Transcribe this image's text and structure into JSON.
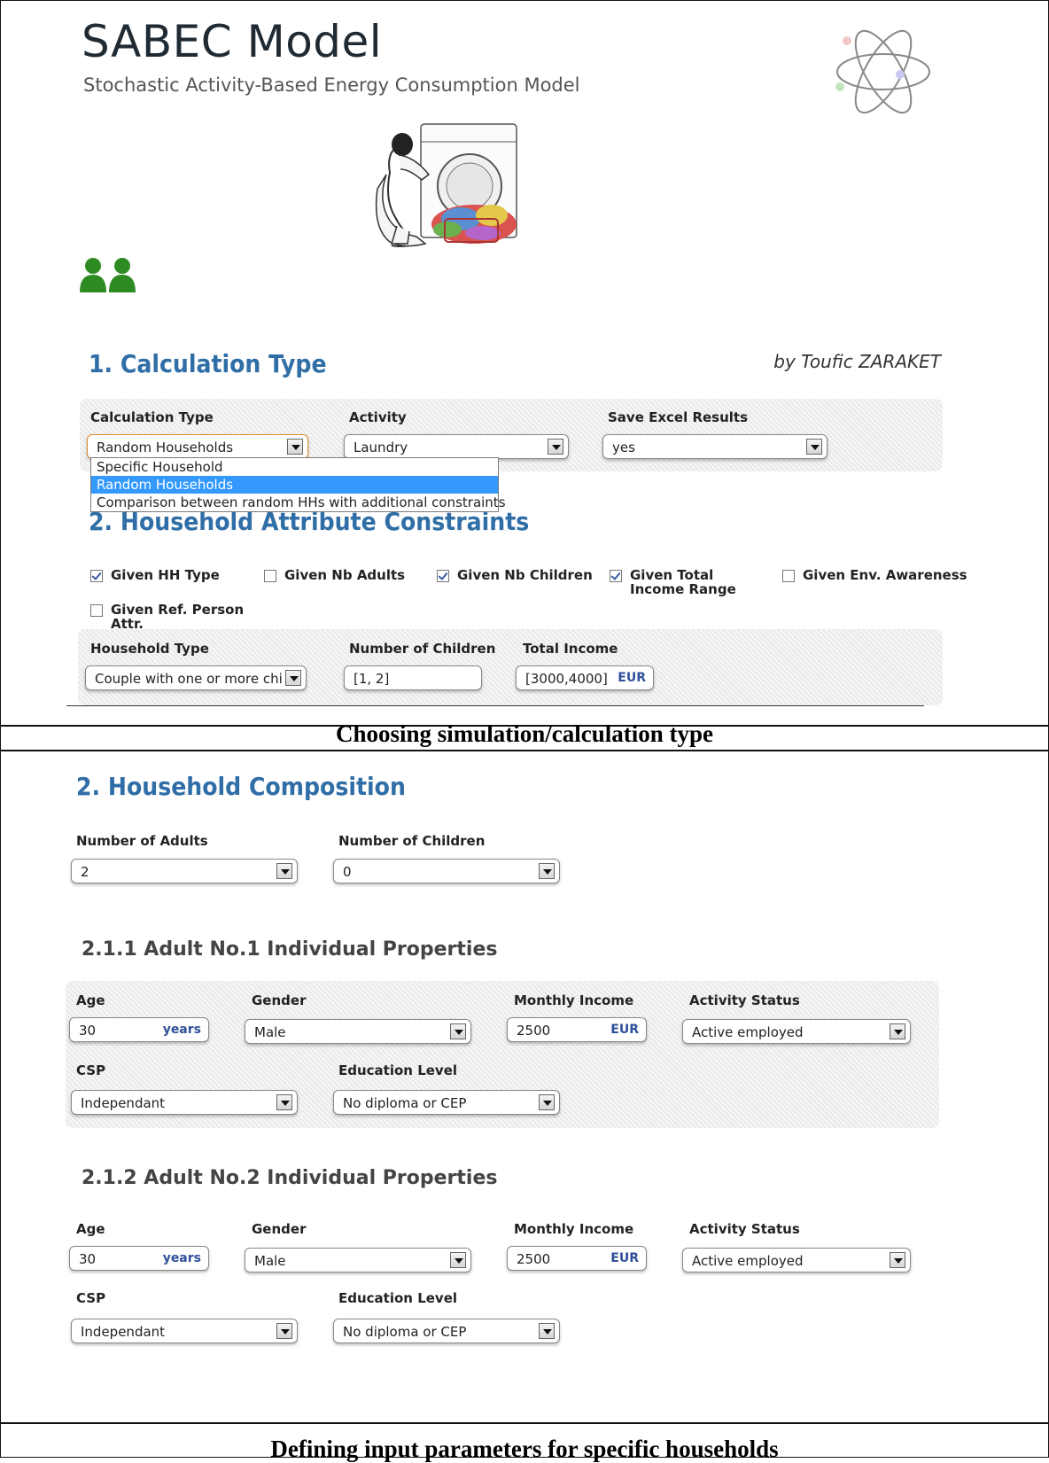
{
  "header": {
    "title": "SABEC Model",
    "subtitle": "Stochastic Activity-Based Energy Consumption Model",
    "author": "by Toufic ZARAKET"
  },
  "panel1": {
    "section1_title": "1. Calculation Type",
    "calc_type_label": "Calculation Type",
    "calc_type_value": "Random Households",
    "activity_label": "Activity",
    "activity_value": "Laundry",
    "save_excel_label": "Save Excel Results",
    "save_excel_value": "yes",
    "calc_type_options": [
      "Specific Household",
      "Random Households",
      "Comparison between random HHs with additional constraints"
    ],
    "section2_title": "2. Household Attribute Constraints",
    "checkboxes": [
      {
        "label": "Given HH Type",
        "checked": true
      },
      {
        "label": "Given Nb Adults",
        "checked": false
      },
      {
        "label": "Given Nb Children",
        "checked": true
      },
      {
        "label": "Given Total Income Range",
        "checked": true
      },
      {
        "label": "Given Env. Awareness",
        "checked": false
      },
      {
        "label": "Given Ref. Person Attr.",
        "checked": false
      }
    ],
    "household_type_label": "Household Type",
    "household_type_value": "Couple with one or more chi",
    "nb_children_label": "Number of Children",
    "nb_children_value": "[1, 2]",
    "total_income_label": "Total Income",
    "total_income_value": "[3000,4000]",
    "total_income_unit": "EUR"
  },
  "caption1": "Choosing simulation/calculation type",
  "panel2": {
    "section_title": "2. Household Composition",
    "nb_adults_label": "Number of Adults",
    "nb_adults_value": "2",
    "nb_children_label": "Number of Children",
    "nb_children_value": "0",
    "adults": [
      {
        "title": "2.1.1 Adult No.1 Individual Properties",
        "age_label": "Age",
        "age_value": "30",
        "age_unit": "years",
        "gender_label": "Gender",
        "gender_value": "Male",
        "income_label": "Monthly Income",
        "income_value": "2500",
        "income_unit": "EUR",
        "activity_label": "Activity Status",
        "activity_value": "Active employed",
        "csp_label": "CSP",
        "csp_value": "Independant",
        "education_label": "Education Level",
        "education_value": "No diploma or CEP"
      },
      {
        "title": "2.1.2 Adult No.2 Individual Properties",
        "age_label": "Age",
        "age_value": "30",
        "age_unit": "years",
        "gender_label": "Gender",
        "gender_value": "Male",
        "income_label": "Monthly Income",
        "income_value": "2500",
        "income_unit": "EUR",
        "activity_label": "Activity Status",
        "activity_value": "Active employed",
        "csp_label": "CSP",
        "csp_value": "Independant",
        "education_label": "Education Level",
        "education_value": "No diploma or CEP"
      }
    ]
  },
  "caption2": "Defining input parameters for specific households",
  "colors": {
    "section_title": "#2f6ea6",
    "highlight": "#3399ff",
    "person_icon": "#2e8b22"
  },
  "icons": [
    "atom-icon",
    "laundry-illustration",
    "users-icon",
    "dropdown-arrow-icon",
    "checkbox-icon"
  ]
}
